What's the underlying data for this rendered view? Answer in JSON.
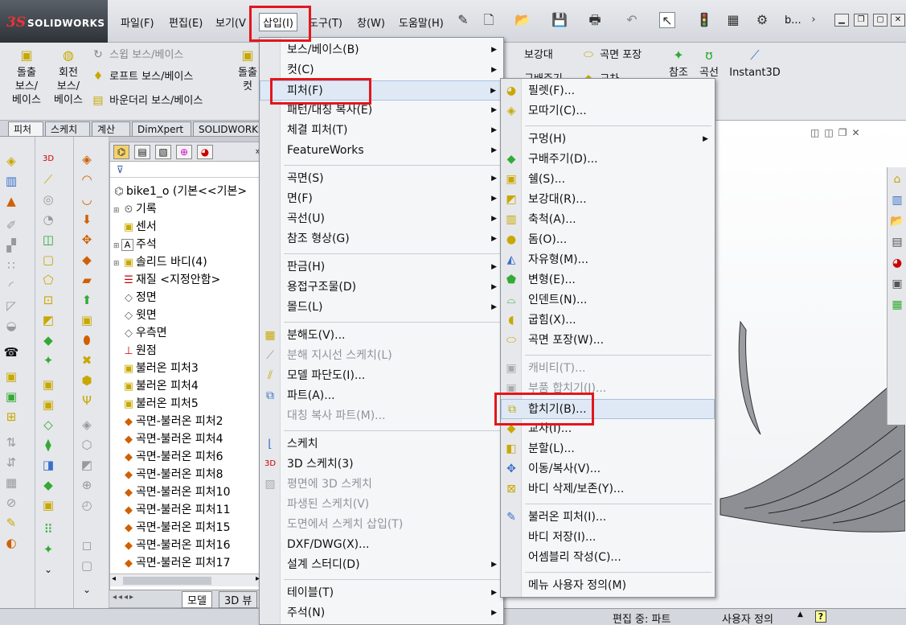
{
  "app": {
    "logo_ds": "3S",
    "logo_name": "SOLIDWORKS",
    "doc_name": "b..."
  },
  "menubar": [
    {
      "label": "파일(F)"
    },
    {
      "label": "편집(E)"
    },
    {
      "label": "보기(V"
    },
    {
      "label": "삽입(I)"
    },
    {
      "label": "도구(T)"
    },
    {
      "label": "창(W)"
    },
    {
      "label": "도움말(H)"
    }
  ],
  "ribbon": {
    "extrude_boss": "돌출\n보스/\n베이스",
    "revolve_boss": "회전\n보스/\n베이스",
    "sweep_boss": "스윕 보스/베이스",
    "loft_boss": "로프트 보스/베이스",
    "boundary_boss": "바운더리 보스/베이스",
    "extrude_cut": "돌출\n컷",
    "rib": "보강대",
    "wrap": "곡면 포장",
    "draft": "구배주기",
    "intersect": "교차",
    "ref_geometry": "참조\n형상",
    "curves": "곡선",
    "instant3d": "Instant3D"
  },
  "cm_tabs": [
    "피처",
    "스케치",
    "계산",
    "DimXpert",
    "SOLIDWORKS"
  ],
  "tree": {
    "root": "bike1_o  (기본<<기본>",
    "nodes": [
      "기록",
      "센서",
      "주석",
      "솔리드 바디(4)",
      "재질 <지정안함>",
      "정면",
      "윗면",
      "우측면",
      "원점",
      "불러온 피처3",
      "불러온 피처4",
      "불러온 피처5",
      "곡면-불러온 피처2",
      "곡면-불러온 피처4",
      "곡면-불러온 피처6",
      "곡면-불러온 피처8",
      "곡면-불러온 피처10",
      "곡면-불러온 피처11",
      "곡면-불러온 피처15",
      "곡면-불러온 피처16",
      "곡면-불러온 피처17"
    ],
    "tab_model": "모델",
    "tab_3d": "3D 뷰"
  },
  "insert_menu": [
    {
      "label": "보스/베이스(B)",
      "sub": true
    },
    {
      "label": "컷(C)",
      "sub": true
    },
    {
      "label": "피처(F)",
      "sub": true
    },
    {
      "label": "패턴/대칭 복사(E)",
      "sub": true
    },
    {
      "label": "체결 피처(T)",
      "sub": true
    },
    {
      "label": "FeatureWorks",
      "sub": true
    },
    {
      "label": "곡면(S)",
      "sub": true
    },
    {
      "label": "면(F)",
      "sub": true
    },
    {
      "label": "곡선(U)",
      "sub": true
    },
    {
      "label": "참조 형상(G)",
      "sub": true
    },
    {
      "label": "판금(H)",
      "sub": true
    },
    {
      "label": "용접구조물(D)",
      "sub": true
    },
    {
      "label": "몰드(L)",
      "sub": true
    },
    {
      "label": "분해도(V)..."
    },
    {
      "label": "분해 지시선 스케치(L)"
    },
    {
      "label": "모델 파단도(I)..."
    },
    {
      "label": "파트(A)..."
    },
    {
      "label": "대칭 복사 파트(M)..."
    },
    {
      "label": "스케치"
    },
    {
      "label": "3D 스케치(3)"
    },
    {
      "label": "평면에 3D 스케치"
    },
    {
      "label": "파생된 스케치(V)"
    },
    {
      "label": "도면에서 스케치 삽입(T)"
    },
    {
      "label": "DXF/DWG(X)..."
    },
    {
      "label": "설계 스터디(D)",
      "sub": true
    },
    {
      "label": "테이블(T)",
      "sub": true
    },
    {
      "label": "주석(N)",
      "sub": true
    }
  ],
  "features_menu": [
    {
      "label": "필렛(F)..."
    },
    {
      "label": "모따기(C)..."
    },
    {
      "label": "구멍(H)",
      "sub": true
    },
    {
      "label": "구배주기(D)..."
    },
    {
      "label": "쉘(S)..."
    },
    {
      "label": "보강대(R)..."
    },
    {
      "label": "축척(A)..."
    },
    {
      "label": "돔(O)..."
    },
    {
      "label": "자유형(M)..."
    },
    {
      "label": "변형(E)..."
    },
    {
      "label": "인덴트(N)..."
    },
    {
      "label": "굽힘(X)..."
    },
    {
      "label": "곡면 포장(W)..."
    },
    {
      "label": "캐비티(T)..."
    },
    {
      "label": "부품 합치기(J)..."
    },
    {
      "label": "합치기(B)..."
    },
    {
      "label": "교차(I)..."
    },
    {
      "label": "분할(L)..."
    },
    {
      "label": "이동/복사(V)..."
    },
    {
      "label": "바디 삭제/보존(Y)..."
    },
    {
      "label": "불러온 피처(I)..."
    },
    {
      "label": "바디 저장(I)..."
    },
    {
      "label": "어셈블리 작성(C)..."
    },
    {
      "label": "메뉴 사용자 정의(M)"
    }
  ],
  "status": {
    "editing": "편집 중: 파트",
    "custom": "사용자 정의",
    "help": "?"
  },
  "colors": {
    "highlight_box": "#e3161c",
    "menu_hover": "#dfe9f5"
  }
}
